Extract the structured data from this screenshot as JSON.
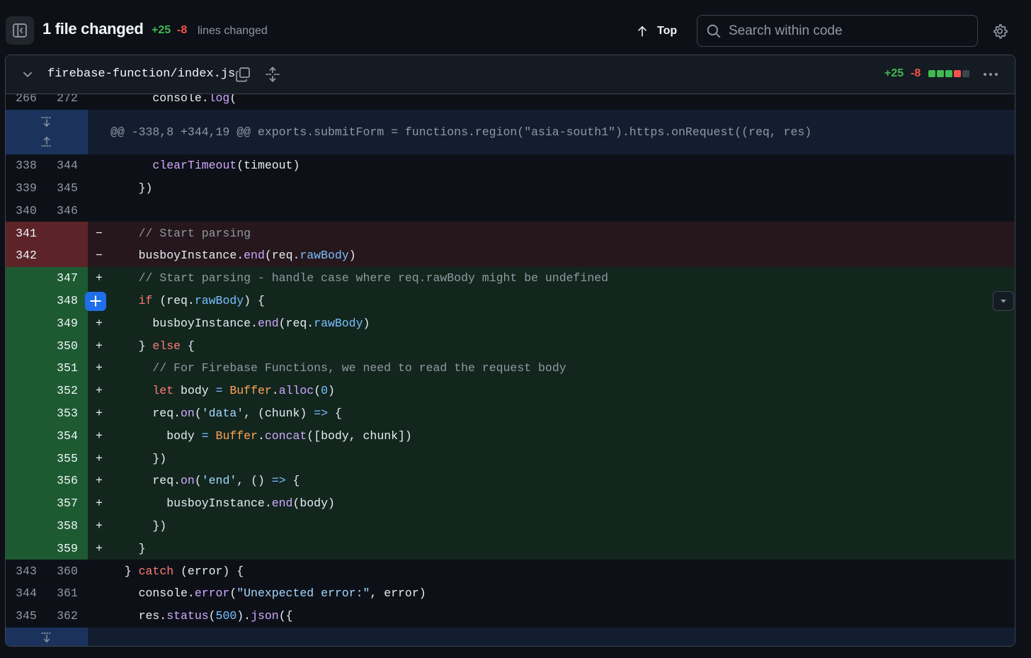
{
  "toolbar": {
    "files_changed": "1 file changed",
    "additions": "+25",
    "deletions": "-8",
    "lines_changed_label": "lines changed",
    "top_label": "Top",
    "search_placeholder": "Search within code"
  },
  "file": {
    "path": "firebase-function/index.js",
    "additions": "+25",
    "deletions": "-8",
    "diffstat": [
      "add",
      "add",
      "add",
      "del",
      "neutral"
    ]
  },
  "diff": {
    "partial_row": {
      "old": "266",
      "new": "272",
      "code": "      console.log("
    },
    "hunk_header": "@@ -338,8 +344,19 @@ exports.submitForm = functions.region(\"asia-south1\").https.onRequest((req, res)",
    "rows": [
      {
        "type": "ctx",
        "old": "338",
        "new": "344",
        "marker": "",
        "code": "      clearTimeout(timeout)"
      },
      {
        "type": "ctx",
        "old": "339",
        "new": "345",
        "marker": "",
        "code": "    })"
      },
      {
        "type": "ctx",
        "old": "340",
        "new": "346",
        "marker": "",
        "code": ""
      },
      {
        "type": "del",
        "old": "341",
        "new": "",
        "marker": "−",
        "code": "    // Start parsing"
      },
      {
        "type": "del",
        "old": "342",
        "new": "",
        "marker": "−",
        "code": "    busboyInstance.end(req.rawBody)"
      },
      {
        "type": "add",
        "old": "",
        "new": "347",
        "marker": "+",
        "code": "    // Start parsing - handle case where req.rawBody might be undefined"
      },
      {
        "type": "add",
        "old": "",
        "new": "348",
        "marker": "+",
        "code": "    if (req.rawBody) {"
      },
      {
        "type": "add",
        "old": "",
        "new": "349",
        "marker": "+",
        "code": "      busboyInstance.end(req.rawBody)"
      },
      {
        "type": "add",
        "old": "",
        "new": "350",
        "marker": "+",
        "code": "    } else {"
      },
      {
        "type": "add",
        "old": "",
        "new": "351",
        "marker": "+",
        "code": "      // For Firebase Functions, we need to read the request body"
      },
      {
        "type": "add",
        "old": "",
        "new": "352",
        "marker": "+",
        "code": "      let body = Buffer.alloc(0)"
      },
      {
        "type": "add",
        "old": "",
        "new": "353",
        "marker": "+",
        "code": "      req.on('data', (chunk) => {"
      },
      {
        "type": "add",
        "old": "",
        "new": "354",
        "marker": "+",
        "code": "        body = Buffer.concat([body, chunk])"
      },
      {
        "type": "add",
        "old": "",
        "new": "355",
        "marker": "+",
        "code": "      })"
      },
      {
        "type": "add",
        "old": "",
        "new": "356",
        "marker": "+",
        "code": "      req.on('end', () => {"
      },
      {
        "type": "add",
        "old": "",
        "new": "357",
        "marker": "+",
        "code": "        busboyInstance.end(body)"
      },
      {
        "type": "add",
        "old": "",
        "new": "358",
        "marker": "+",
        "code": "      })"
      },
      {
        "type": "add",
        "old": "",
        "new": "359",
        "marker": "+",
        "code": "    }"
      },
      {
        "type": "ctx",
        "old": "343",
        "new": "360",
        "marker": "",
        "code": "  } catch (error) {"
      },
      {
        "type": "ctx",
        "old": "344",
        "new": "361",
        "marker": "",
        "code": "    console.error(\"Unexpected error:\", error)"
      },
      {
        "type": "ctx",
        "old": "345",
        "new": "362",
        "marker": "",
        "code": "    res.status(500).json({"
      }
    ]
  },
  "colors": {
    "add": "#3fb950",
    "del": "#f85149",
    "accent": "#1f6feb"
  },
  "icons": {
    "sidebar": "sidebar-collapse-icon",
    "top": "arrow-up-icon",
    "search": "search-icon",
    "settings": "gear-icon",
    "chevron": "chevron-down-icon",
    "copy": "copy-icon",
    "expand": "unfold-icon",
    "more": "kebab-horizontal-icon",
    "comment": "plus-icon",
    "dropdown": "triangle-down-icon",
    "expand_up": "expand-up-icon",
    "expand_down": "expand-down-icon"
  }
}
